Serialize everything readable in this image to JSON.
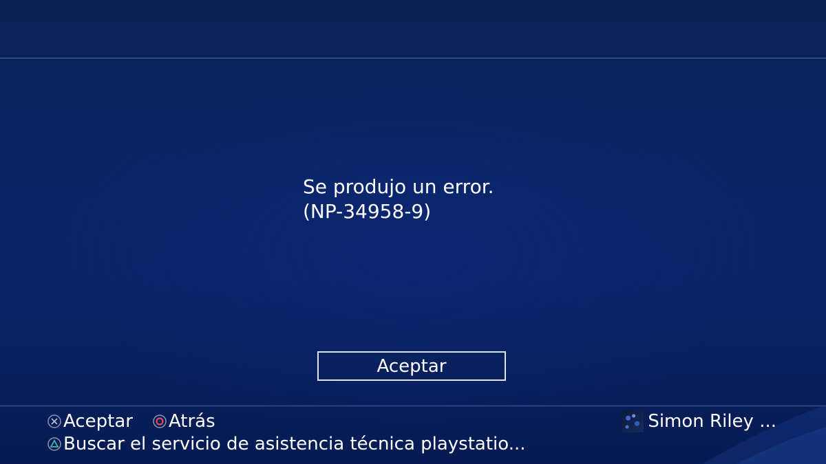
{
  "dialog": {
    "message_line1": "Se produjo un error.",
    "message_line2": "(NP-34958-9)",
    "accept_button": "Aceptar"
  },
  "footer": {
    "hints": [
      {
        "icon": "cross-button-icon",
        "label": "Aceptar"
      },
      {
        "icon": "circle-button-icon",
        "label": "Atrás"
      },
      {
        "icon": "triangle-button-icon",
        "label": "Buscar el servicio de asistencia técnica playstatio..."
      }
    ],
    "user_name": "Simon Riley ..."
  },
  "colors": {
    "background": "#0a2566",
    "cross_icon": "#b9c3d8",
    "circle_icon": "#e0574f",
    "triangle_icon": "#41b8a0"
  }
}
